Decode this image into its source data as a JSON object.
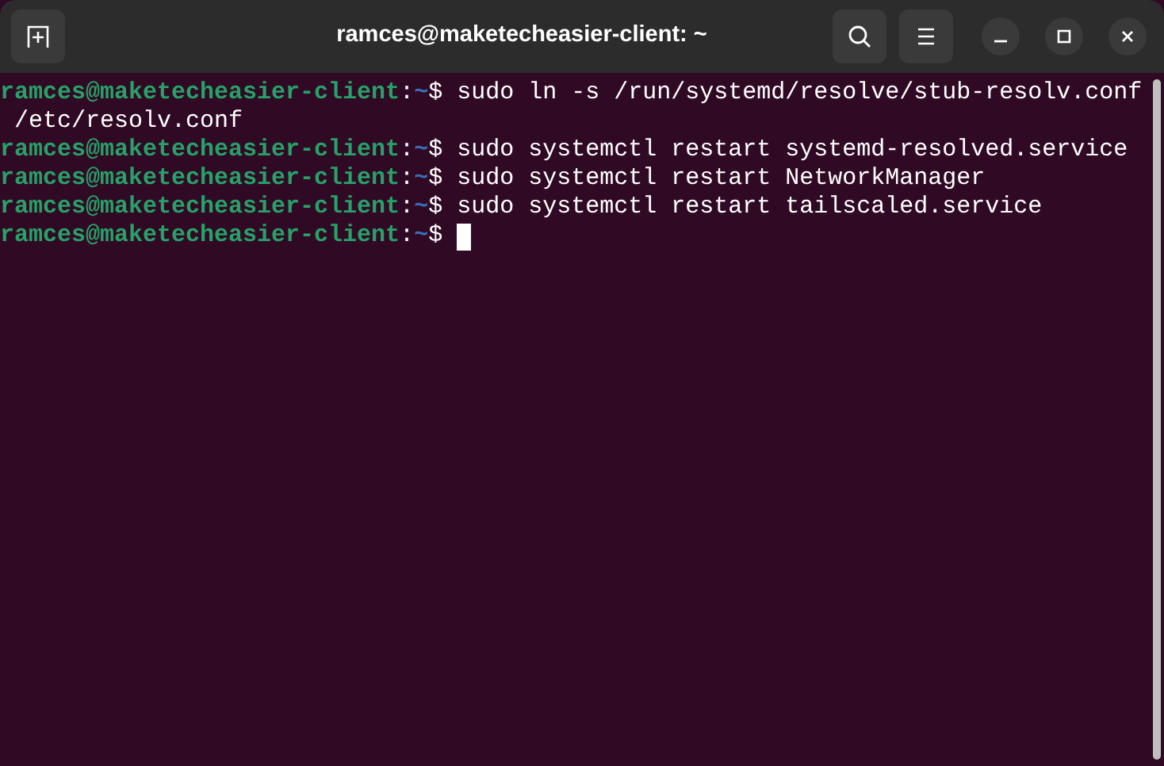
{
  "window": {
    "title": "ramces@maketecheasier-client: ~"
  },
  "terminal": {
    "lines": [
      {
        "kind": "prompt",
        "user_host": "ramces@maketecheasier-client",
        "separator": ":",
        "path": "~",
        "symbol": "$",
        "command": "sudo ln -s /run/systemd/resolve/stub-resolv.conf"
      },
      {
        "kind": "output",
        "text": " /etc/resolv.conf"
      },
      {
        "kind": "prompt",
        "user_host": "ramces@maketecheasier-client",
        "separator": ":",
        "path": "~",
        "symbol": "$",
        "command": "sudo systemctl restart systemd-resolved.service"
      },
      {
        "kind": "prompt",
        "user_host": "ramces@maketecheasier-client",
        "separator": ":",
        "path": "~",
        "symbol": "$",
        "command": "sudo systemctl restart NetworkManager"
      },
      {
        "kind": "prompt",
        "user_host": "ramces@maketecheasier-client",
        "separator": ":",
        "path": "~",
        "symbol": "$",
        "command": "sudo systemctl restart tailscaled.service"
      },
      {
        "kind": "prompt",
        "user_host": "ramces@maketecheasier-client",
        "separator": ":",
        "path": "~",
        "symbol": "$",
        "cursor": true
      }
    ]
  }
}
